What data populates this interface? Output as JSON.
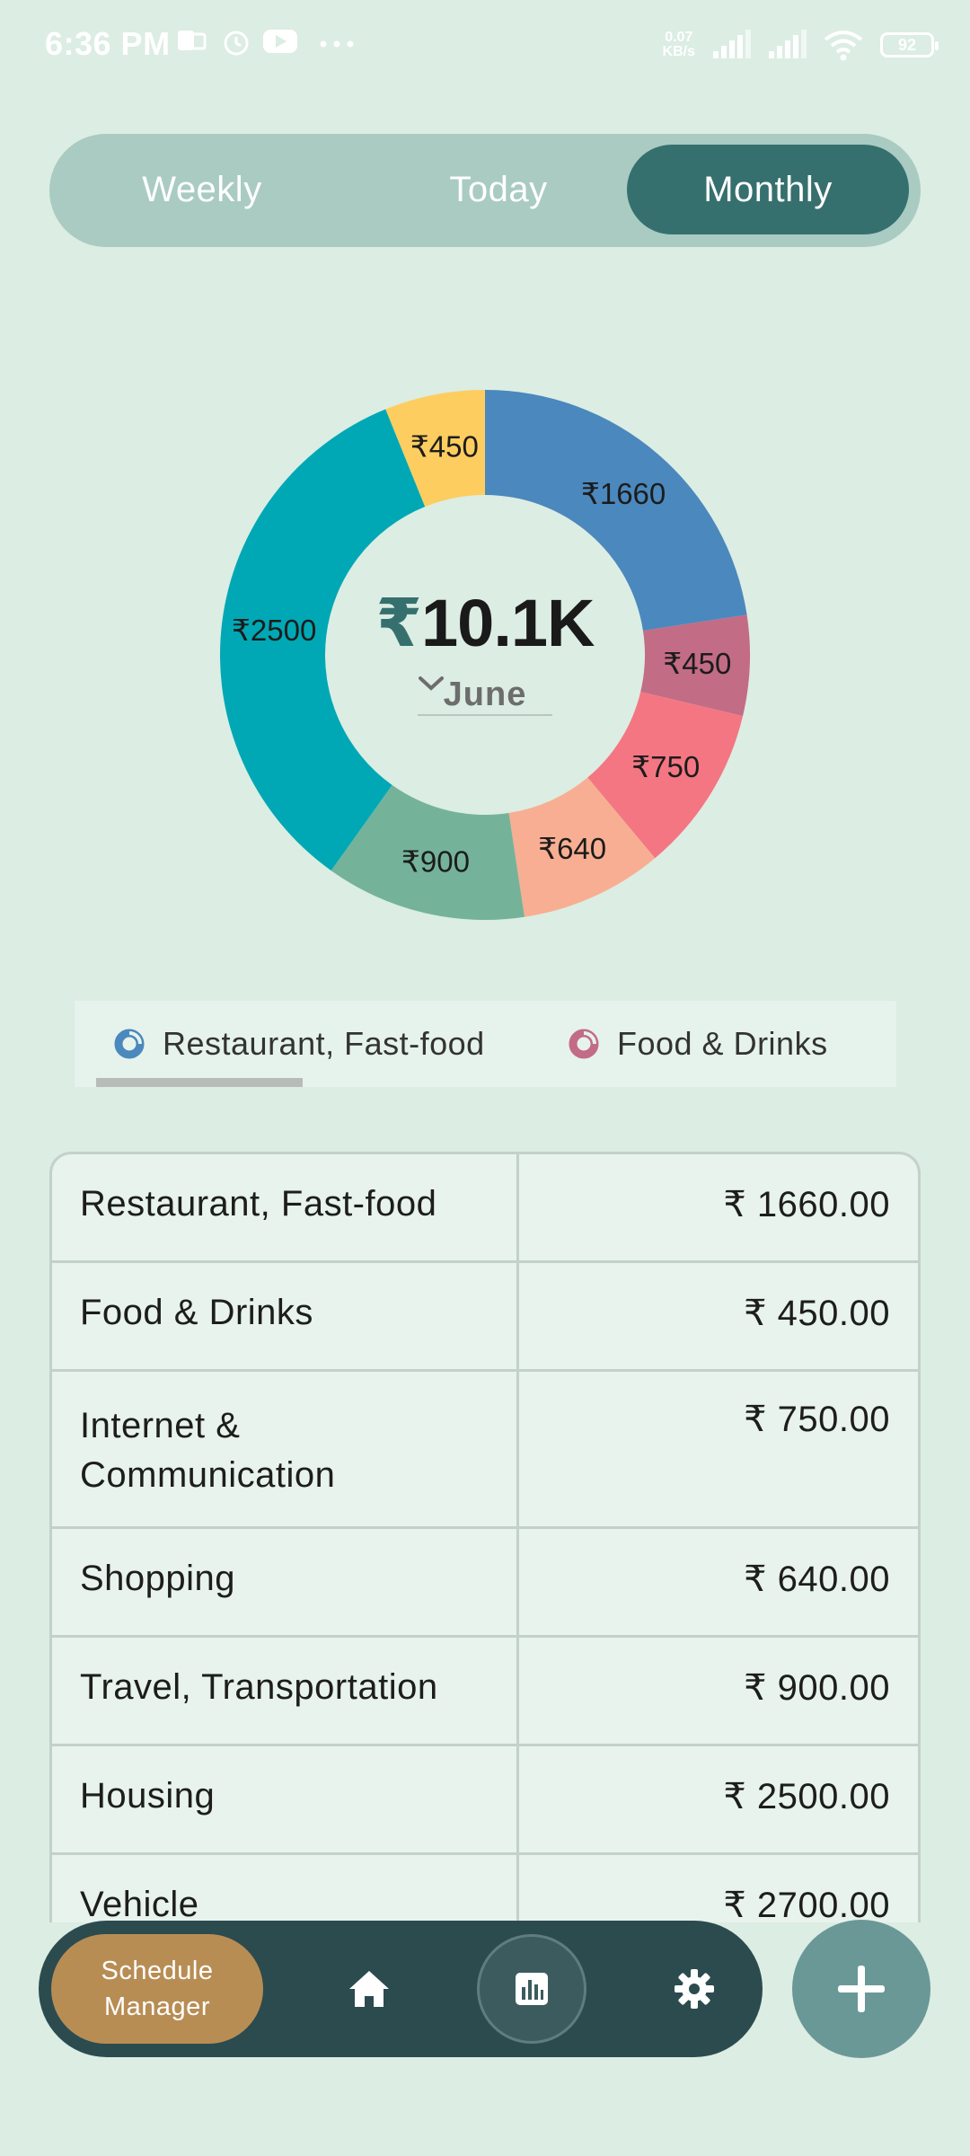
{
  "status_bar": {
    "time": "6:36 PM",
    "net_speed_value": "0.07",
    "net_speed_unit": "KB/s",
    "battery": "92"
  },
  "period_tabs": [
    {
      "label": "Weekly",
      "selected": false
    },
    {
      "label": "Today",
      "selected": false
    },
    {
      "label": "Monthly",
      "selected": true
    }
  ],
  "summary": {
    "currency_symbol": "₹",
    "total_amount": "10.1K",
    "month": "June"
  },
  "chart_data": {
    "type": "pie",
    "style": "donut",
    "slices": [
      {
        "label": "₹1660",
        "value": 1660,
        "color": "#4b88bd"
      },
      {
        "label": "₹450",
        "value": 450,
        "color": "#c26c86"
      },
      {
        "label": "₹750",
        "value": 750,
        "color": "#f47683"
      },
      {
        "label": "₹640",
        "value": 640,
        "color": "#f8ae92"
      },
      {
        "label": "₹900",
        "value": 900,
        "color": "#74b39a"
      },
      {
        "label": "₹2500",
        "value": 2500,
        "color": "#00a8b5"
      },
      {
        "label": "₹450",
        "value": 450,
        "color": "#fdcd60"
      }
    ]
  },
  "category_tabs": [
    {
      "label": "Restaurant, Fast-food",
      "color": "#4b88bd",
      "selected": true
    },
    {
      "label": "Food & Drinks",
      "color": "#c26c86",
      "selected": false
    }
  ],
  "expense_table": {
    "rows": [
      {
        "category": "Restaurant, Fast-food",
        "amount": "₹ 1660.00"
      },
      {
        "category": "Food & Drinks",
        "amount": "₹ 450.00"
      },
      {
        "category": "Internet & Communication",
        "amount": "₹ 750.00"
      },
      {
        "category": "Shopping",
        "amount": "₹ 640.00"
      },
      {
        "category": "Travel, Transportation",
        "amount": "₹ 900.00"
      },
      {
        "category": "Housing",
        "amount": "₹ 2500.00"
      },
      {
        "category": "Vehicle",
        "amount": "₹ 2700.00"
      }
    ]
  },
  "bottom_nav": {
    "schedule_label_line1": "Schedule",
    "schedule_label_line2": "Manager",
    "icons": [
      "home-icon",
      "bar-chart-icon",
      "gear-icon"
    ],
    "active": "bar-chart-icon"
  },
  "fab": {
    "icon": "plus-icon"
  },
  "colors": {
    "background": "#dcede3",
    "accent": "#36706e",
    "nav_background": "#2b4b4f",
    "schedule_button": "#b88d54",
    "fab": "#699897"
  }
}
